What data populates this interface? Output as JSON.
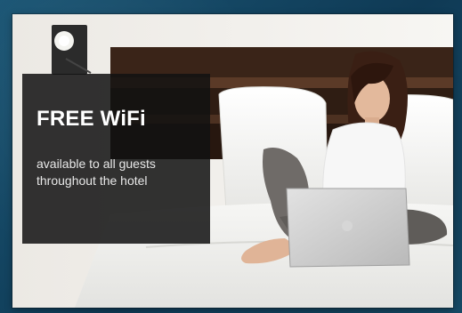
{
  "promo": {
    "title": "FREE WiFi",
    "line1": "available to all guests",
    "line2": "throughout the hotel"
  },
  "colors": {
    "background": "#13445f",
    "overlay": "#121212",
    "headboard": "#3a2418",
    "laptop": "#c9c9c9"
  },
  "icons": {
    "lamp": "wall-lamp-icon",
    "laptop": "laptop-icon"
  }
}
